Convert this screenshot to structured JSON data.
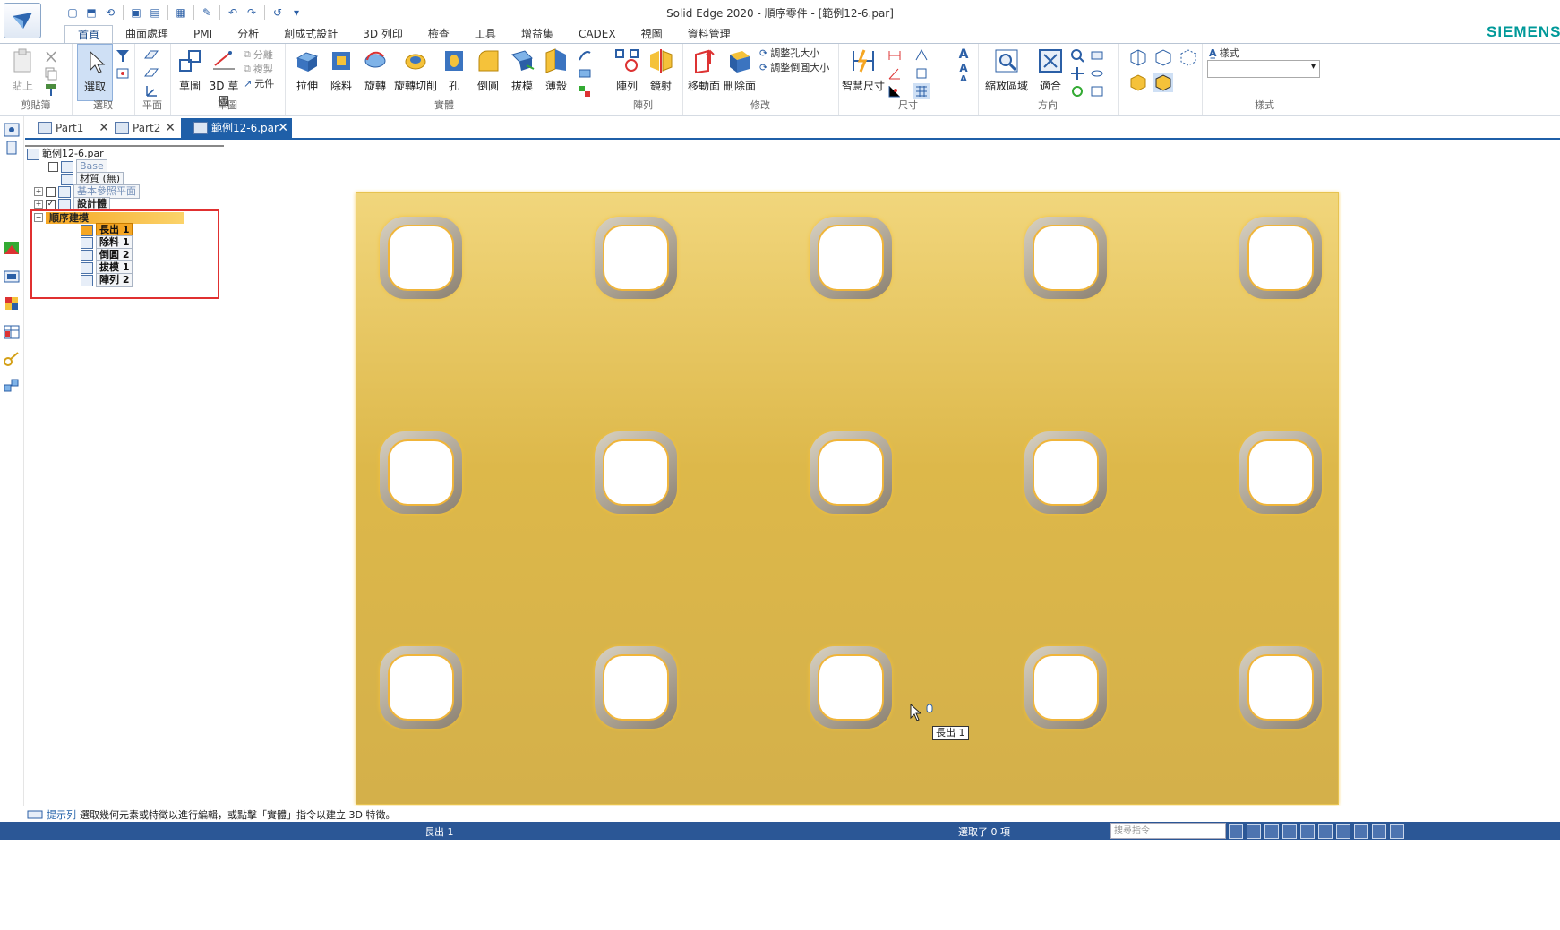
{
  "app": {
    "window_title": "Solid Edge 2020 - 順序零件 - [範例12-6.par]",
    "brand": "SIEMENS"
  },
  "ribbon_tabs": [
    "首頁",
    "曲面處理",
    "PMI",
    "分析",
    "創成式設計",
    "3D 列印",
    "檢查",
    "工具",
    "增益集",
    "CADEX",
    "視圖",
    "資料管理"
  ],
  "ribbon": {
    "clipboard": {
      "paste": "貼上",
      "group": "剪貼簿"
    },
    "select": {
      "select": "選取",
      "group": "選取"
    },
    "plane": {
      "group": "平面"
    },
    "sketch": {
      "sketch": "草圖",
      "sketch3d": "3D 草圖",
      "split": "分離",
      "copy": "複製",
      "element": "元件",
      "group": "草圖"
    },
    "solid": {
      "extrude": "拉伸",
      "cut": "除料",
      "revolve": "旋轉",
      "revolve_cut": "旋轉切削",
      "hole": "孔",
      "round": "倒圓",
      "draft": "拔模",
      "thin_wall": "薄殼",
      "group": "實體"
    },
    "pattern": {
      "pattern": "陣列",
      "mirror": "鏡射",
      "group": "陣列"
    },
    "modify": {
      "move_face": "移動面",
      "delete_face": "刪除面",
      "resize_hole": "調整孔大小",
      "resize_round": "調整倒圓大小",
      "group": "修改"
    },
    "dimension": {
      "smart_dim": "智慧尺寸",
      "group": "尺寸"
    },
    "orient": {
      "zoom_area": "縮放區域",
      "fit": "適合",
      "group": "方向"
    },
    "style": {
      "style_label": "樣式",
      "group": "樣式"
    }
  },
  "doc_tabs": [
    {
      "label": "Part1"
    },
    {
      "label": "Part2"
    },
    {
      "label": "範例12-6.par",
      "active": true
    }
  ],
  "tree": {
    "root": "範例12-6.par",
    "base": "Base",
    "material": "材質 (無)",
    "ref_planes": "基本參照平面",
    "design_body": "設計體",
    "ordered": "順序建模",
    "features": [
      "長出 1",
      "除料 1",
      "倒圓 2",
      "拔模 1",
      "陣列 2"
    ]
  },
  "viewport": {
    "part_color": "#d9b54a",
    "hole_rows": 3,
    "hole_cols": 5,
    "cursor_tooltip": "長出 1"
  },
  "prompt": {
    "label": "提示列",
    "text": "選取幾何元素或特徵以進行編輯，或點擊「實體」指令以建立 3D 特徵。"
  },
  "status": {
    "left": "長出 1",
    "selection": "選取了 0 項",
    "search_placeholder": "搜尋指令"
  }
}
